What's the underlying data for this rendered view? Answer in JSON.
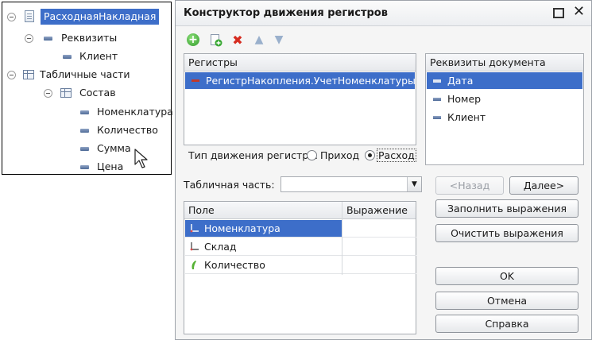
{
  "tree": {
    "root": "РасходнаяНакладная",
    "nodes": [
      {
        "label": "Реквизиты"
      },
      {
        "label": "Клиент"
      },
      {
        "label": "Табличные части"
      },
      {
        "label": "Состав"
      },
      {
        "label": "Номенклатура"
      },
      {
        "label": "Количество"
      },
      {
        "label": "Сумма"
      },
      {
        "label": "Цена"
      }
    ]
  },
  "dialog": {
    "title": "Конструктор движения регистров",
    "registers": {
      "header": "Регистры",
      "items": [
        "РегистрНакопления.УчетНоменклатуры"
      ]
    },
    "doc_attrs": {
      "header": "Реквизиты документа",
      "items": [
        "Дата",
        "Номер",
        "Клиент"
      ]
    },
    "movement_type": {
      "label": "Тип движения регистра:",
      "options": [
        "Приход",
        "Расход"
      ],
      "selected": "Расход"
    },
    "tabular": {
      "label": "Табличная часть:",
      "value": ""
    },
    "grid": {
      "columns": [
        "Поле",
        "Выражение"
      ],
      "rows": [
        {
          "field": "Номенклатура",
          "expr": ""
        },
        {
          "field": "Склад",
          "expr": ""
        },
        {
          "field": "Количество",
          "expr": ""
        }
      ]
    },
    "buttons": {
      "back": "<Назад",
      "next": "Далее>",
      "fill": "Заполнить выражения",
      "clear": "Очистить выражения",
      "ok": "OK",
      "cancel": "Отмена",
      "help": "Справка"
    },
    "colors": {
      "selection": "#3d6ec9",
      "add_icon": "#2f9a2a",
      "delete_icon": "#d62b1f"
    }
  }
}
